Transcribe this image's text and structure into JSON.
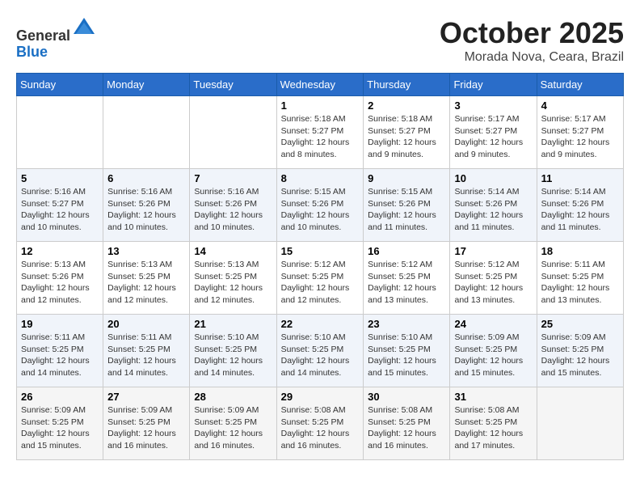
{
  "header": {
    "logo_line1": "General",
    "logo_line2": "Blue",
    "month": "October 2025",
    "location": "Morada Nova, Ceara, Brazil"
  },
  "weekdays": [
    "Sunday",
    "Monday",
    "Tuesday",
    "Wednesday",
    "Thursday",
    "Friday",
    "Saturday"
  ],
  "weeks": [
    [
      {
        "day": "",
        "info": ""
      },
      {
        "day": "",
        "info": ""
      },
      {
        "day": "",
        "info": ""
      },
      {
        "day": "1",
        "info": "Sunrise: 5:18 AM\nSunset: 5:27 PM\nDaylight: 12 hours and 8 minutes."
      },
      {
        "day": "2",
        "info": "Sunrise: 5:18 AM\nSunset: 5:27 PM\nDaylight: 12 hours and 9 minutes."
      },
      {
        "day": "3",
        "info": "Sunrise: 5:17 AM\nSunset: 5:27 PM\nDaylight: 12 hours and 9 minutes."
      },
      {
        "day": "4",
        "info": "Sunrise: 5:17 AM\nSunset: 5:27 PM\nDaylight: 12 hours and 9 minutes."
      }
    ],
    [
      {
        "day": "5",
        "info": "Sunrise: 5:16 AM\nSunset: 5:27 PM\nDaylight: 12 hours and 10 minutes."
      },
      {
        "day": "6",
        "info": "Sunrise: 5:16 AM\nSunset: 5:26 PM\nDaylight: 12 hours and 10 minutes."
      },
      {
        "day": "7",
        "info": "Sunrise: 5:16 AM\nSunset: 5:26 PM\nDaylight: 12 hours and 10 minutes."
      },
      {
        "day": "8",
        "info": "Sunrise: 5:15 AM\nSunset: 5:26 PM\nDaylight: 12 hours and 10 minutes."
      },
      {
        "day": "9",
        "info": "Sunrise: 5:15 AM\nSunset: 5:26 PM\nDaylight: 12 hours and 11 minutes."
      },
      {
        "day": "10",
        "info": "Sunrise: 5:14 AM\nSunset: 5:26 PM\nDaylight: 12 hours and 11 minutes."
      },
      {
        "day": "11",
        "info": "Sunrise: 5:14 AM\nSunset: 5:26 PM\nDaylight: 12 hours and 11 minutes."
      }
    ],
    [
      {
        "day": "12",
        "info": "Sunrise: 5:13 AM\nSunset: 5:26 PM\nDaylight: 12 hours and 12 minutes."
      },
      {
        "day": "13",
        "info": "Sunrise: 5:13 AM\nSunset: 5:25 PM\nDaylight: 12 hours and 12 minutes."
      },
      {
        "day": "14",
        "info": "Sunrise: 5:13 AM\nSunset: 5:25 PM\nDaylight: 12 hours and 12 minutes."
      },
      {
        "day": "15",
        "info": "Sunrise: 5:12 AM\nSunset: 5:25 PM\nDaylight: 12 hours and 12 minutes."
      },
      {
        "day": "16",
        "info": "Sunrise: 5:12 AM\nSunset: 5:25 PM\nDaylight: 12 hours and 13 minutes."
      },
      {
        "day": "17",
        "info": "Sunrise: 5:12 AM\nSunset: 5:25 PM\nDaylight: 12 hours and 13 minutes."
      },
      {
        "day": "18",
        "info": "Sunrise: 5:11 AM\nSunset: 5:25 PM\nDaylight: 12 hours and 13 minutes."
      }
    ],
    [
      {
        "day": "19",
        "info": "Sunrise: 5:11 AM\nSunset: 5:25 PM\nDaylight: 12 hours and 14 minutes."
      },
      {
        "day": "20",
        "info": "Sunrise: 5:11 AM\nSunset: 5:25 PM\nDaylight: 12 hours and 14 minutes."
      },
      {
        "day": "21",
        "info": "Sunrise: 5:10 AM\nSunset: 5:25 PM\nDaylight: 12 hours and 14 minutes."
      },
      {
        "day": "22",
        "info": "Sunrise: 5:10 AM\nSunset: 5:25 PM\nDaylight: 12 hours and 14 minutes."
      },
      {
        "day": "23",
        "info": "Sunrise: 5:10 AM\nSunset: 5:25 PM\nDaylight: 12 hours and 15 minutes."
      },
      {
        "day": "24",
        "info": "Sunrise: 5:09 AM\nSunset: 5:25 PM\nDaylight: 12 hours and 15 minutes."
      },
      {
        "day": "25",
        "info": "Sunrise: 5:09 AM\nSunset: 5:25 PM\nDaylight: 12 hours and 15 minutes."
      }
    ],
    [
      {
        "day": "26",
        "info": "Sunrise: 5:09 AM\nSunset: 5:25 PM\nDaylight: 12 hours and 15 minutes."
      },
      {
        "day": "27",
        "info": "Sunrise: 5:09 AM\nSunset: 5:25 PM\nDaylight: 12 hours and 16 minutes."
      },
      {
        "day": "28",
        "info": "Sunrise: 5:09 AM\nSunset: 5:25 PM\nDaylight: 12 hours and 16 minutes."
      },
      {
        "day": "29",
        "info": "Sunrise: 5:08 AM\nSunset: 5:25 PM\nDaylight: 12 hours and 16 minutes."
      },
      {
        "day": "30",
        "info": "Sunrise: 5:08 AM\nSunset: 5:25 PM\nDaylight: 12 hours and 16 minutes."
      },
      {
        "day": "31",
        "info": "Sunrise: 5:08 AM\nSunset: 5:25 PM\nDaylight: 12 hours and 17 minutes."
      },
      {
        "day": "",
        "info": ""
      }
    ]
  ]
}
